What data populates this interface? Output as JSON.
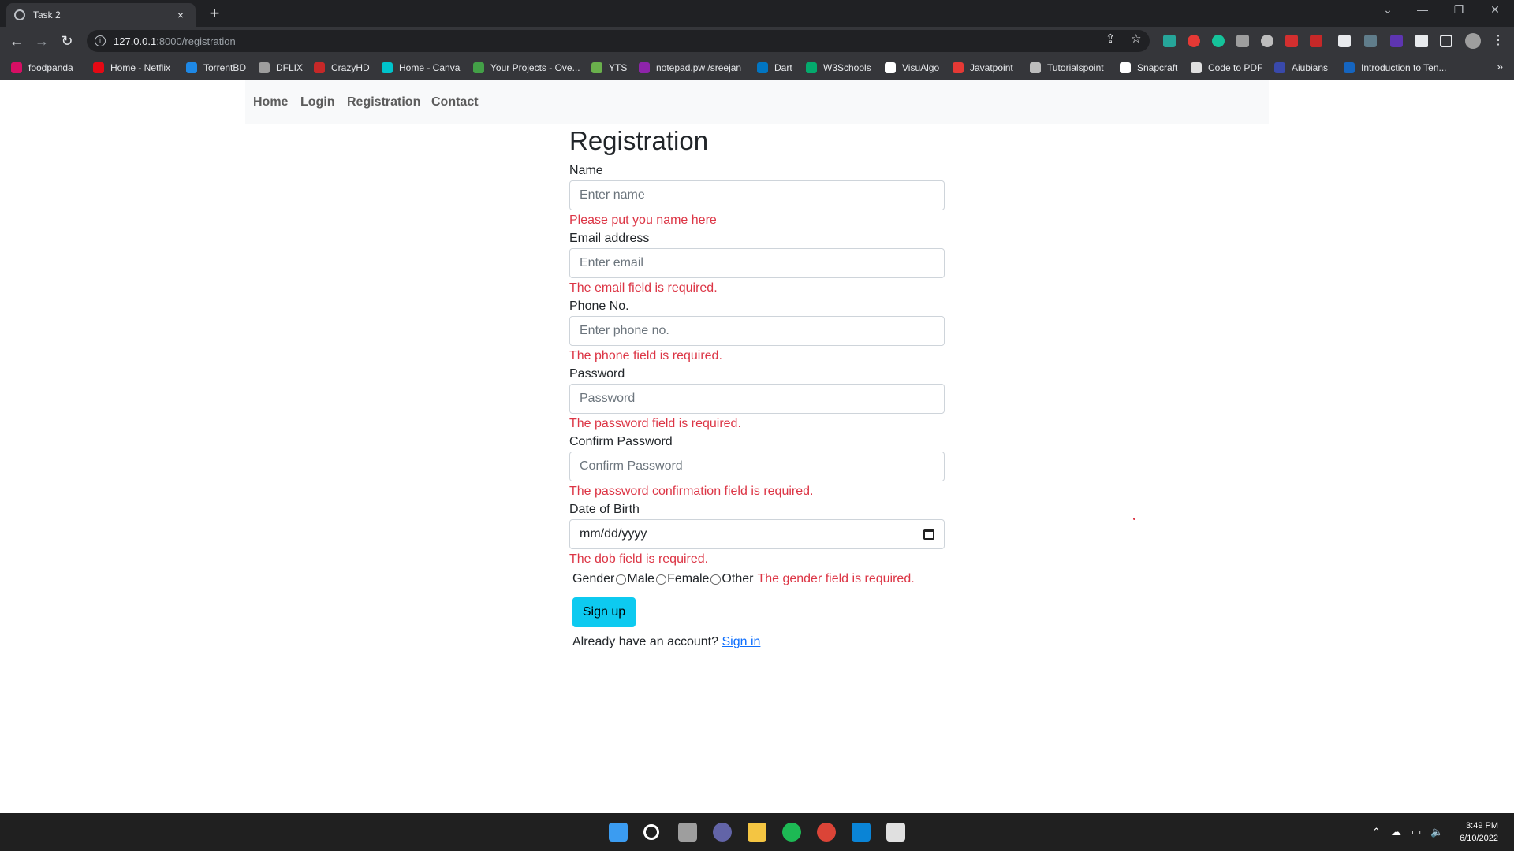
{
  "browser": {
    "tab_title": "Task 2",
    "tab_close": "×",
    "new_tab": "+",
    "url_host": "127.0.0.1",
    "url_path": ":8000/registration",
    "bookmarks": [
      {
        "label": "foodpanda",
        "color": "#d70f64"
      },
      {
        "label": "Home - Netflix",
        "color": "#e50914"
      },
      {
        "label": "TorrentBD",
        "color": "#1e88e5"
      },
      {
        "label": "DFLIX",
        "color": "#9e9e9e"
      },
      {
        "label": "CrazyHD",
        "color": "#c62828"
      },
      {
        "label": "Home - Canva",
        "color": "#00c4cc"
      },
      {
        "label": "Your Projects - Ove...",
        "color": "#43a047"
      },
      {
        "label": "YTS",
        "color": "#6ab04c"
      },
      {
        "label": "notepad.pw /sreejan",
        "color": "#8e24aa"
      },
      {
        "label": "Dart",
        "color": "#0175c2"
      },
      {
        "label": "W3Schools",
        "color": "#04aa6d"
      },
      {
        "label": "VisuAlgo",
        "color": "#ffffff"
      },
      {
        "label": "Javatpoint",
        "color": "#e53935"
      },
      {
        "label": "Tutorialspoint",
        "color": "#bdbdbd"
      },
      {
        "label": "Snapcraft",
        "color": "#ffffff"
      },
      {
        "label": "Code to PDF",
        "color": "#e0e0e0"
      },
      {
        "label": "Aiubians",
        "color": "#3949ab"
      },
      {
        "label": "Introduction to Ten...",
        "color": "#1565c0"
      }
    ],
    "bookmarks_more": "»"
  },
  "nav": {
    "items": [
      "Home",
      "Login",
      "Registration",
      "Contact"
    ]
  },
  "form": {
    "title": "Registration",
    "name": {
      "label": "Name",
      "placeholder": "Enter name",
      "error": "Please put you name here"
    },
    "email": {
      "label": "Email address",
      "placeholder": "Enter email",
      "error": "The email field is required."
    },
    "phone": {
      "label": "Phone No.",
      "placeholder": "Enter phone no.",
      "error": "The phone field is required."
    },
    "password": {
      "label": "Password",
      "placeholder": "Password",
      "error": "The password field is required."
    },
    "confirm": {
      "label": "Confirm Password",
      "placeholder": "Confirm Password",
      "error": "The password confirmation field is required."
    },
    "dob": {
      "label": "Date of Birth",
      "value": "mm/dd/yyyy",
      "error": "The dob field is required."
    },
    "gender": {
      "label": "Gender",
      "options": [
        "Male",
        "Female",
        "Other"
      ],
      "error": "The gender field is required."
    },
    "submit": "Sign up",
    "signin_prompt": "Already have an account?",
    "signin_link": "Sign in"
  },
  "taskbar": {
    "time": "3:49 PM",
    "date": "6/10/2022"
  }
}
